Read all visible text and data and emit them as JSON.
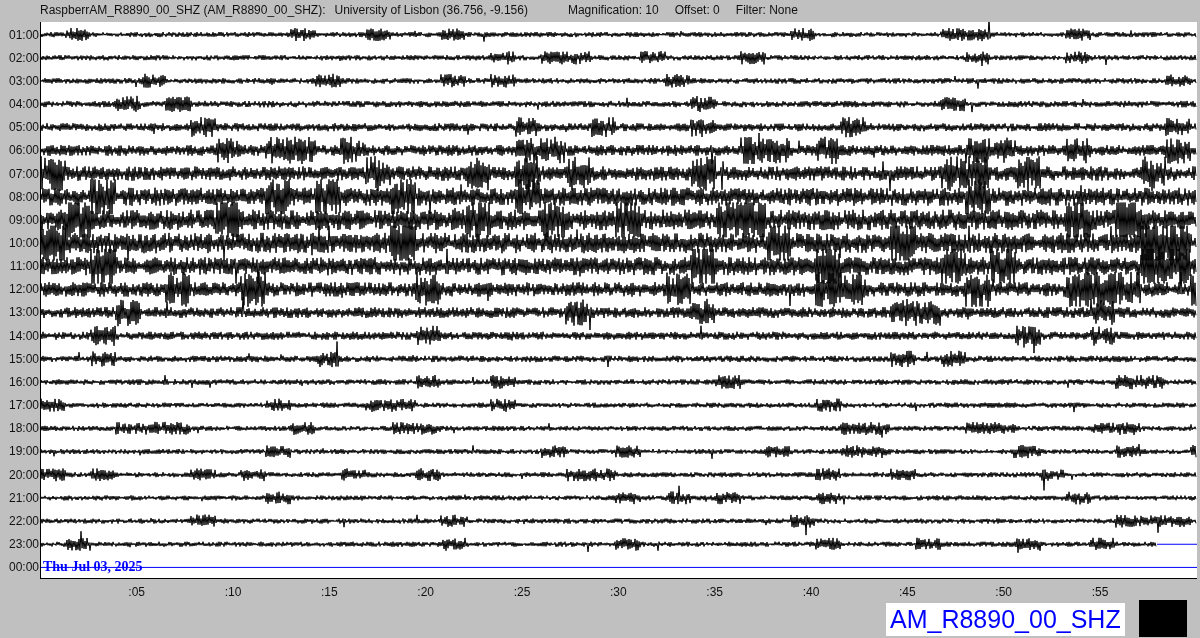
{
  "header": {
    "station": "RaspberrAM_R8890_00_SHZ (AM_R8890_00_SHZ):",
    "location": "University of Lisbon (36.756, -9.156)",
    "magnification": "Magnification: 10",
    "offset": "Offset: 0",
    "filter": "Filter: None"
  },
  "rows": [
    {
      "label": "01:00",
      "kind": "trace"
    },
    {
      "label": "02:00",
      "kind": "trace"
    },
    {
      "label": "03:00",
      "kind": "trace"
    },
    {
      "label": "04:00",
      "kind": "trace"
    },
    {
      "label": "05:00",
      "kind": "trace"
    },
    {
      "label": "06:00",
      "kind": "trace"
    },
    {
      "label": "07:00",
      "kind": "trace"
    },
    {
      "label": "08:00",
      "kind": "trace"
    },
    {
      "label": "09:00",
      "kind": "trace"
    },
    {
      "label": "10:00",
      "kind": "trace"
    },
    {
      "label": "11:00",
      "kind": "trace"
    },
    {
      "label": "12:00",
      "kind": "trace"
    },
    {
      "label": "13:00",
      "kind": "trace"
    },
    {
      "label": "14:00",
      "kind": "trace"
    },
    {
      "label": "15:00",
      "kind": "trace"
    },
    {
      "label": "16:00",
      "kind": "trace"
    },
    {
      "label": "17:00",
      "kind": "trace"
    },
    {
      "label": "18:00",
      "kind": "trace"
    },
    {
      "label": "19:00",
      "kind": "trace"
    },
    {
      "label": "20:00",
      "kind": "trace"
    },
    {
      "label": "21:00",
      "kind": "trace"
    },
    {
      "label": "22:00",
      "kind": "trace"
    },
    {
      "label": "23:00",
      "kind": "partial"
    },
    {
      "label": "00:00",
      "kind": "pending"
    }
  ],
  "date": "Thu Jul 03, 2025",
  "x_ticks": [
    ":05",
    ":10",
    ":15",
    ":20",
    ":25",
    ":30",
    ":35",
    ":40",
    ":45",
    ":50",
    ":55"
  ],
  "channel_label": "AM_R8890_00_SHZ"
}
